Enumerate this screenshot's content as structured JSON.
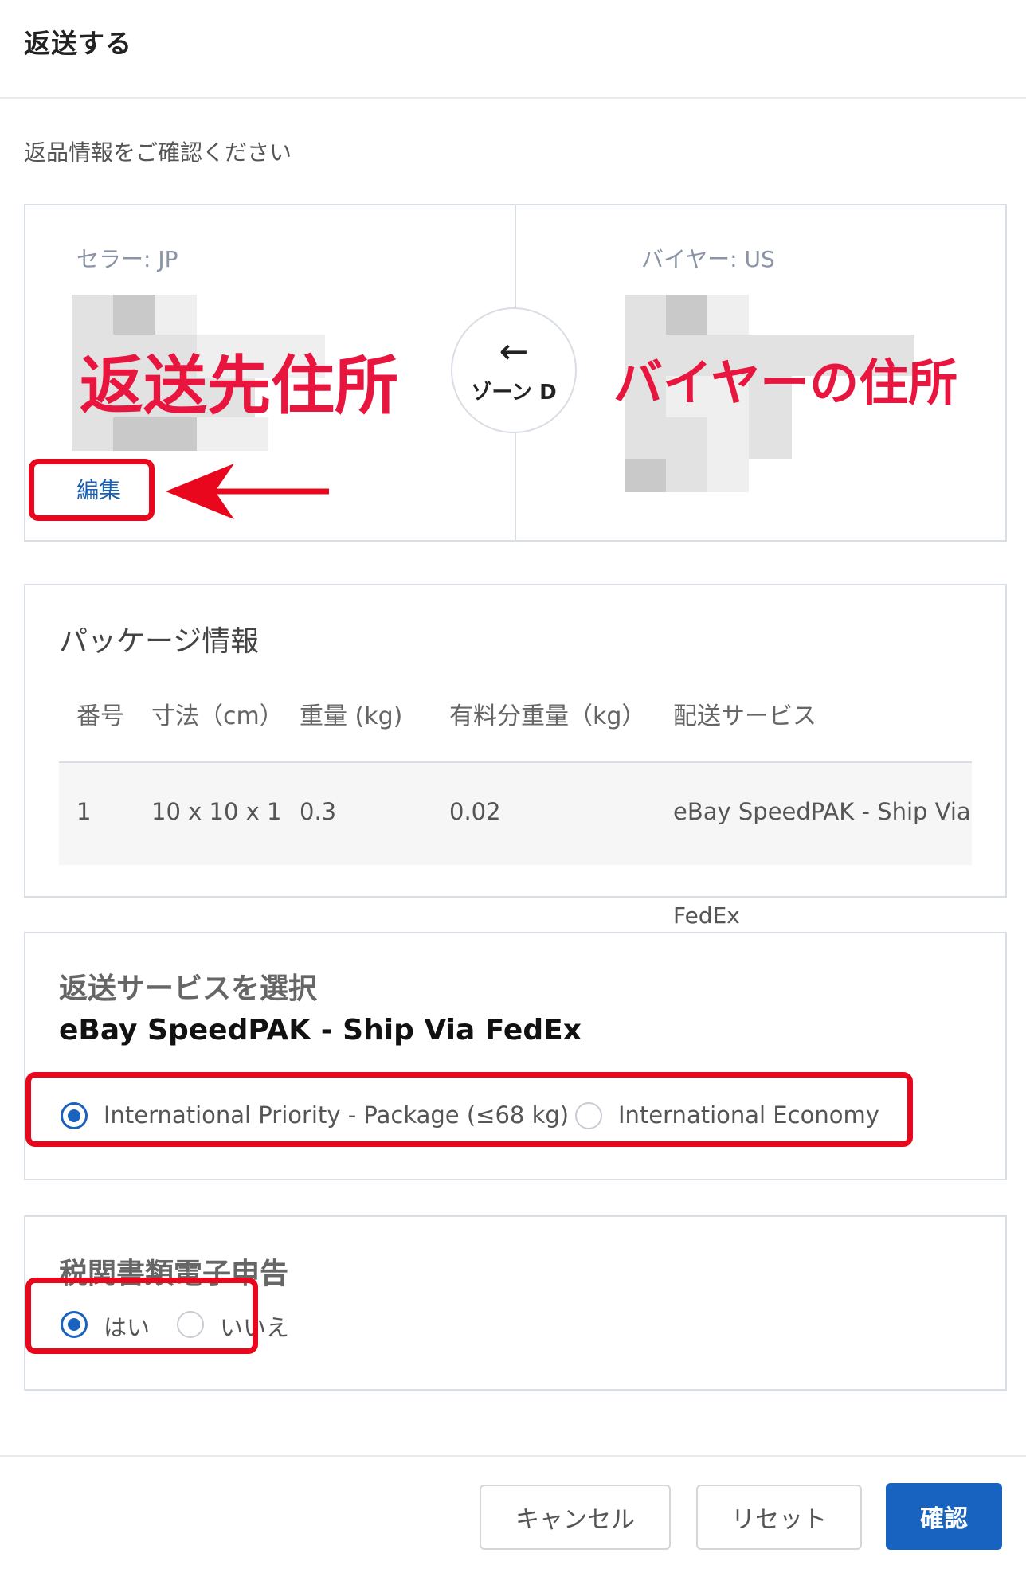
{
  "dialog": {
    "title": "返送する",
    "subtitle": "返品情報をご確認ください"
  },
  "addresses": {
    "seller_label": "セラー: JP",
    "buyer_label": "バイヤー: US",
    "zone_label": "ゾーン D",
    "edit_label": "編集",
    "annotation_return_address": "返送先住所",
    "annotation_buyer_address": "バイヤーの住所"
  },
  "package": {
    "title": "パッケージ情報",
    "columns": [
      "番号",
      "寸法（cm）",
      "重量 (kg)",
      "有料分重量（kg）",
      "配送サービス"
    ],
    "rows": [
      [
        "1",
        "10 x 10 x 1",
        "0.3",
        "0.02",
        "eBay SpeedPAK - Ship Via"
      ]
    ],
    "service_overflow": "FedEx"
  },
  "return_service": {
    "heading": "返送サービスを選択",
    "service_name": "eBay SpeedPAK - Ship Via FedEx",
    "options": [
      {
        "label": "International Priority - Package (≤68 kg)",
        "selected": true
      },
      {
        "label": "International Economy",
        "selected": false
      }
    ]
  },
  "customs": {
    "title": "税関書類電子申告",
    "options": [
      {
        "label": "はい",
        "selected": true
      },
      {
        "label": "いいえ",
        "selected": false
      }
    ]
  },
  "footer": {
    "cancel_label": "キャンセル",
    "reset_label": "リセット",
    "confirm_label": "確認"
  },
  "colors": {
    "accent": "#1862c0",
    "annotation_red": "#e8071c"
  }
}
